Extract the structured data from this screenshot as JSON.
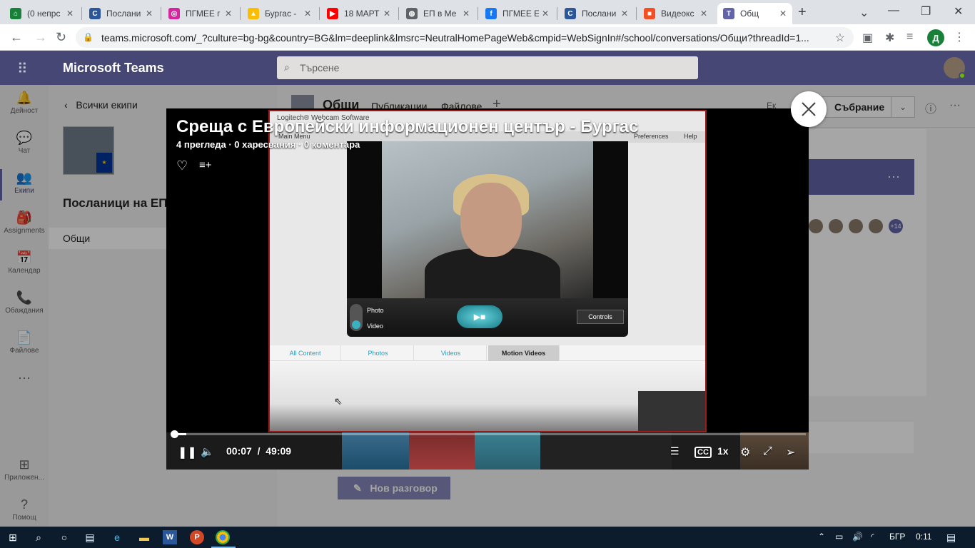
{
  "browser": {
    "tabs": [
      {
        "title": "(0 непрс",
        "icon": "home-icon",
        "color": "#188038",
        "glyph": "⌂"
      },
      {
        "title": "Послани",
        "icon": "document-icon",
        "color": "#2b579a",
        "glyph": "C"
      },
      {
        "title": "ПГМЕЕ г",
        "icon": "instagram-icon",
        "color": "#d6249f",
        "glyph": "◎"
      },
      {
        "title": "Бургас -",
        "icon": "drive-icon",
        "color": "#fbbc04",
        "glyph": "▲"
      },
      {
        "title": "18 МАРТ",
        "icon": "youtube-icon",
        "color": "#ff0000",
        "glyph": "▶"
      },
      {
        "title": "ЕП в Ме",
        "icon": "globe-icon",
        "color": "#5f6368",
        "glyph": "◍"
      },
      {
        "title": "ПГМЕЕ Е",
        "icon": "facebook-icon",
        "color": "#1877f2",
        "glyph": "f"
      },
      {
        "title": "Послани",
        "icon": "document-icon",
        "color": "#2b579a",
        "glyph": "C"
      },
      {
        "title": "Видеокс",
        "icon": "microsoft-icon",
        "color": "#f25022",
        "glyph": "■"
      },
      {
        "title": "Общ",
        "icon": "teams-icon",
        "color": "#6264a7",
        "glyph": "T",
        "active": true
      }
    ],
    "url": "teams.microsoft.com/_?culture=bg-bg&country=BG&lm=deeplink&lmsrc=NeutralHomePageWeb&cmpid=WebSignIn#/school/conversations/Общи?threadId=1...",
    "profile_letter": "Д"
  },
  "teams": {
    "app_title": "Microsoft Teams",
    "search_placeholder": "Търсене",
    "rail": [
      {
        "label": "Дейност",
        "icon": "bell-icon",
        "glyph": "🔔"
      },
      {
        "label": "Чат",
        "icon": "chat-icon",
        "glyph": "💬"
      },
      {
        "label": "Екипи",
        "icon": "teams-icon",
        "glyph": "👥",
        "active": true
      },
      {
        "label": "Assignments",
        "icon": "assignments-icon",
        "glyph": "🎒"
      },
      {
        "label": "Календар",
        "icon": "calendar-icon",
        "glyph": "📅"
      },
      {
        "label": "Обаждания",
        "icon": "phone-icon",
        "glyph": "📞"
      },
      {
        "label": "Файлове",
        "icon": "file-icon",
        "glyph": "📄"
      },
      {
        "label": "",
        "icon": "more-icon",
        "glyph": "···"
      }
    ],
    "rail_bottom": [
      {
        "label": "Приложен...",
        "icon": "apps-icon",
        "glyph": "⊞"
      },
      {
        "label": "Помощ",
        "icon": "help-icon",
        "glyph": "?"
      }
    ],
    "back_label": "Всички екипи",
    "team_name": "Посланици на ЕП",
    "channel_name": "Общи",
    "channel_header": {
      "title": "Общи",
      "tabs": [
        "Публикации",
        "Файлове"
      ],
      "meet_label": "Събрание",
      "meet_prefix": "Ек"
    },
    "new_conversation": "Нов разговор",
    "people_extra": "+14"
  },
  "video": {
    "title": "Среща с Европейски информационен център - Бургас",
    "stats": "4 прегледа · 0 харесвания · 0 коментара",
    "current_time": "00:07",
    "separator": "/",
    "duration": "49:09",
    "progress": 0.0024,
    "speed": "1x",
    "webcam": {
      "title": "Logitech® Webcam Software",
      "menu": "Main Menu",
      "preferences": "Preferences",
      "help": "Help",
      "mode_photo": "Photo",
      "mode_video": "Video",
      "controls": "Controls",
      "tabs": [
        "All Content",
        "Photos",
        "Videos",
        "Motion Videos"
      ],
      "selected_tab": "Motion Videos"
    }
  },
  "taskbar": {
    "language": "БГР",
    "time": "0:11"
  }
}
